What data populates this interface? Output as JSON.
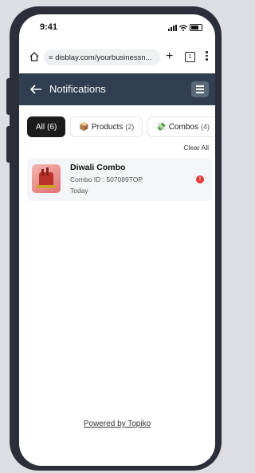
{
  "status_bar": {
    "time": "9:41"
  },
  "browser": {
    "url": "disblay.com/yourbusinessn...",
    "tab_count": "1"
  },
  "header": {
    "title": "Notifications"
  },
  "filters": [
    {
      "label": "All",
      "count": "(6)",
      "glyph": ""
    },
    {
      "label": "Products",
      "count": "(2)",
      "glyph": "📦"
    },
    {
      "label": "Combos",
      "count": "(4)",
      "glyph": "💸"
    }
  ],
  "clear_all": "Clear All",
  "notifications": [
    {
      "title": "Diwali Combo",
      "subtitle": "Combo ID : 507089TOP",
      "time": "Today",
      "badge": "!"
    }
  ],
  "footer": {
    "powered_by": "Powered by Topiko"
  },
  "colors": {
    "header_bg": "#2f3e50",
    "active_chip": "#1c1c1c",
    "badge": "#e53935"
  }
}
